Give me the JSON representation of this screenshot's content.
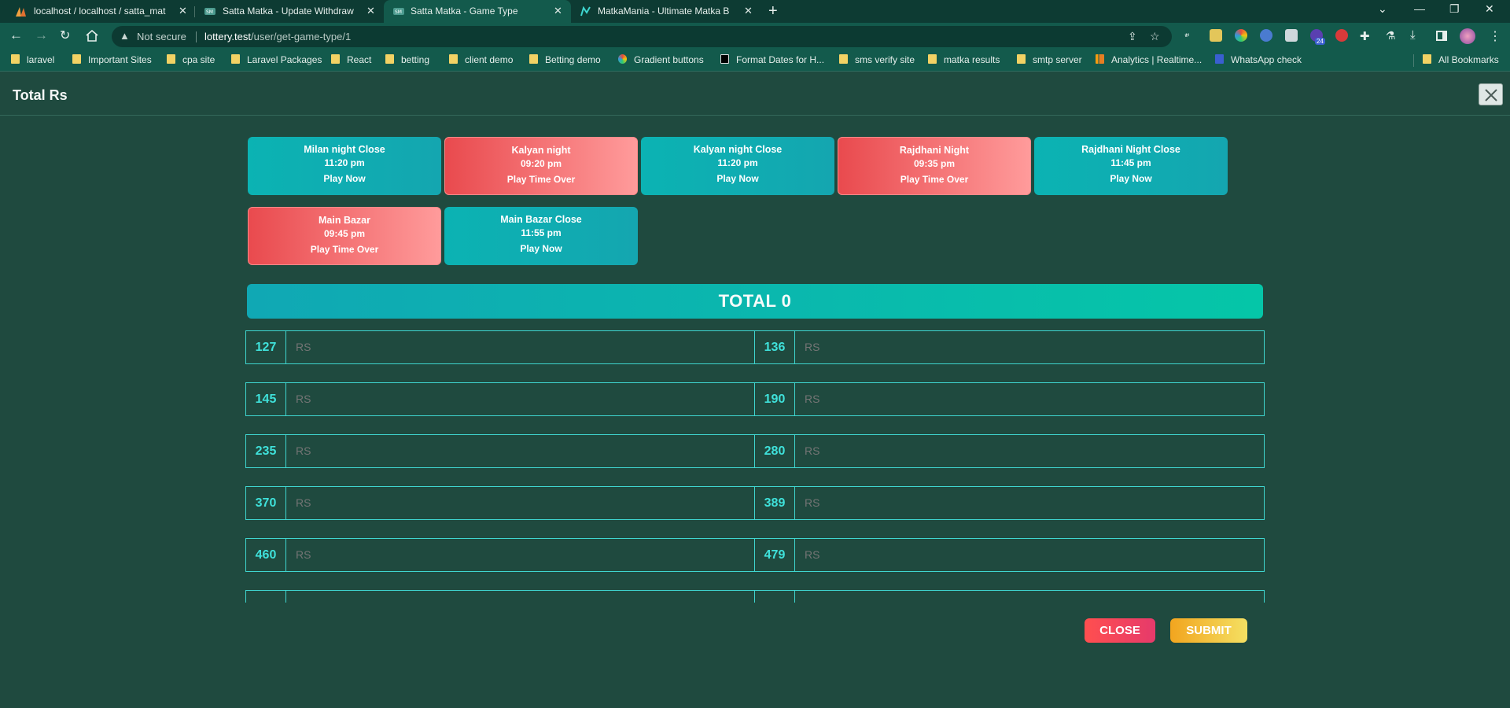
{
  "browser": {
    "tabs": [
      {
        "label": "localhost / localhost / satta_mat",
        "close": "✕"
      },
      {
        "label": "Satta Matka - Update Withdraw",
        "close": "✕"
      },
      {
        "label": "Satta Matka - Game Type",
        "close": "✕"
      },
      {
        "label": "MatkaMania - Ultimate Matka B",
        "close": "✕"
      }
    ],
    "security": "Not secure",
    "url_host": "lottery.test",
    "url_path": "/user/get-game-type/1",
    "bookmarks": [
      "laravel",
      "Important Sites",
      "cpa site",
      "Laravel Packages",
      "React",
      "betting",
      "client demo",
      "Betting demo",
      "Gradient buttons",
      "Format Dates for H...",
      "sms verify site",
      "matka results",
      "smtp server",
      "Analytics | Realtime...",
      "WhatsApp  check",
      "All Bookmarks"
    ],
    "extension_badge": "24"
  },
  "page": {
    "title": "Total Rs"
  },
  "games": [
    {
      "name": "Milan night Close",
      "time": "11:20 pm",
      "status": "Play Now",
      "state": "open"
    },
    {
      "name": "Kalyan night",
      "time": "09:20 pm",
      "status": "Play Time Over",
      "state": "over"
    },
    {
      "name": "Kalyan night Close",
      "time": "11:20 pm",
      "status": "Play Now",
      "state": "open"
    },
    {
      "name": "Rajdhani Night",
      "time": "09:35 pm",
      "status": "Play Time Over",
      "state": "over"
    },
    {
      "name": "Rajdhani Night Close",
      "time": "11:45 pm",
      "status": "Play Now",
      "state": "open"
    },
    {
      "name": "Main Bazar",
      "time": "09:45 pm",
      "status": "Play Time Over",
      "state": "over"
    },
    {
      "name": "Main Bazar Close",
      "time": "11:55 pm",
      "status": "Play Now",
      "state": "open"
    }
  ],
  "total": {
    "label": "TOTAL 0"
  },
  "bets": {
    "placeholder": "RS",
    "rows": [
      [
        "127",
        "136"
      ],
      [
        "145",
        "190"
      ],
      [
        "235",
        "280"
      ],
      [
        "370",
        "389"
      ],
      [
        "460",
        "479"
      ],
      [
        "",
        ""
      ]
    ]
  },
  "buttons": {
    "close": "CLOSE",
    "submit": "SUBMIT"
  },
  "colors": {
    "background": "#1f4a3f",
    "open_card": "#0bb3b3",
    "over_card": "#e94a4e",
    "accent": "#3fd6d0"
  }
}
